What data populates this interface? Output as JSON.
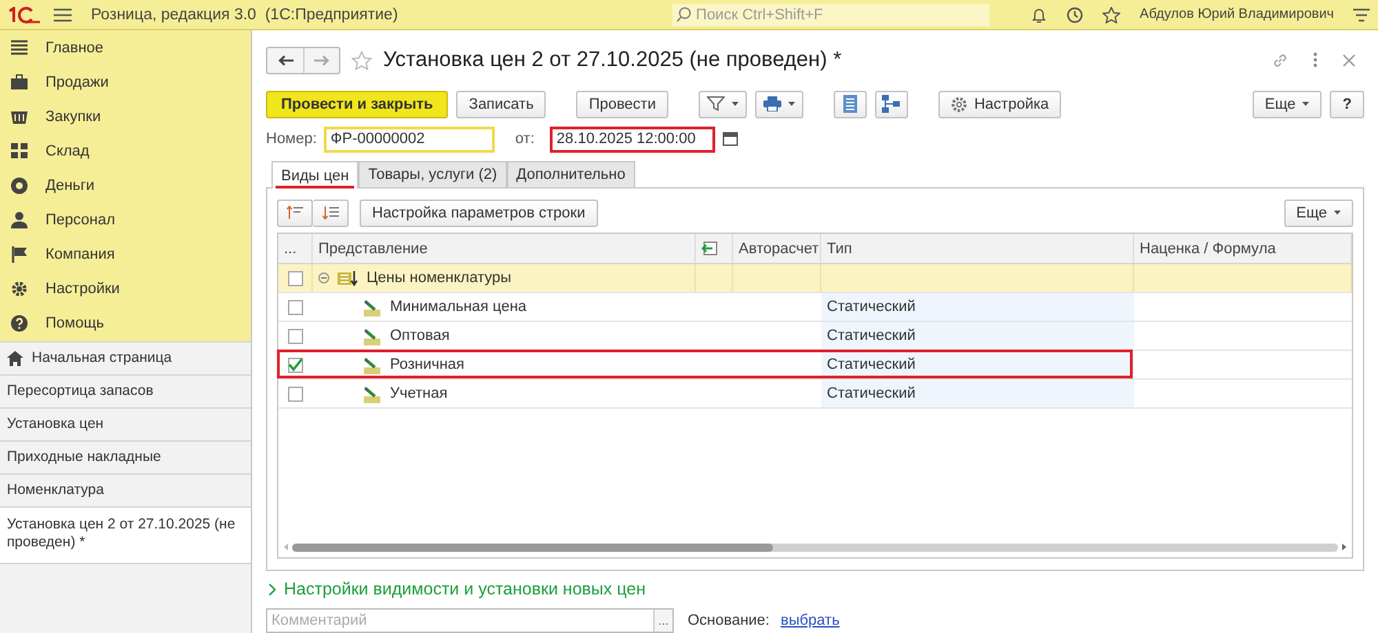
{
  "app": {
    "title": "Розница, редакция 3.0  (1С:Предприятие)",
    "search_placeholder": "Поиск Ctrl+Shift+F",
    "user": "Абдулов Юрий Владимирович"
  },
  "sections": [
    {
      "label": "Главное"
    },
    {
      "label": "Продажи"
    },
    {
      "label": "Закупки"
    },
    {
      "label": "Склад"
    },
    {
      "label": "Деньги"
    },
    {
      "label": "Персонал"
    },
    {
      "label": "Компания"
    },
    {
      "label": "Настройки"
    },
    {
      "label": "Помощь"
    }
  ],
  "open_windows": [
    {
      "label": "Начальная страница",
      "kind": "home",
      "selected": false
    },
    {
      "label": "Пересортица запасов",
      "kind": "page",
      "selected": false
    },
    {
      "label": "Установка цен",
      "kind": "page",
      "selected": false
    },
    {
      "label": "Приходные накладные",
      "kind": "page",
      "selected": false
    },
    {
      "label": "Номенклатура",
      "kind": "page",
      "selected": false
    },
    {
      "label": "Установка цен 2 от 27.10.2025 (не проведен) *",
      "kind": "page",
      "selected": true
    }
  ],
  "document": {
    "title": "Установка цен 2 от 27.10.2025 (не проведен) *",
    "toolbar": [
      {
        "kind": "default",
        "label": "Провести и закрыть"
      },
      {
        "kind": "text",
        "label": "Записать"
      },
      {
        "kind": "text",
        "label": "Провести"
      },
      {
        "kind": "filter"
      },
      {
        "kind": "print"
      },
      {
        "kind": "report"
      },
      {
        "kind": "structure"
      },
      {
        "kind": "gear",
        "label": "Настройка"
      }
    ],
    "more_button": "Еще",
    "help_button": "?",
    "number_label": "Номер:",
    "number": "ФР-00000002",
    "date_label": "от:",
    "date": "28.10.2025 12:00:00",
    "date_highlighted": true,
    "tabs": [
      {
        "label": "Виды цен",
        "selected": true,
        "highlighted": true
      },
      {
        "label": "Товары, услуги (2)",
        "selected": false,
        "highlighted": false
      },
      {
        "label": "Дополнительно",
        "selected": false,
        "highlighted": false
      }
    ],
    "row_settings_button": "Настройка параметров строки",
    "table_more_button": "Еще",
    "columns": [
      "...",
      "Представление",
      "Авторасчет",
      "Тип",
      "Наценка / Формула"
    ],
    "rows": [
      {
        "name": "Цены номенклатуры",
        "checked": false,
        "expanded": true,
        "children": [
          {
            "name": "Минимальная цена",
            "checked": false,
            "type": "Статический",
            "highlighted": false
          },
          {
            "name": "Оптовая",
            "checked": false,
            "type": "Статический",
            "highlighted": false
          },
          {
            "name": "Розничная",
            "checked": true,
            "type": "Статический",
            "highlighted": true
          },
          {
            "name": "Учетная",
            "checked": false,
            "type": "Статический",
            "highlighted": false
          }
        ]
      }
    ],
    "settings_link": "Настройки видимости и установки новых цен",
    "comment_placeholder": "Комментарий",
    "comment_button": "...",
    "basis_label": "Основание:",
    "basis_link": "выбрать"
  }
}
